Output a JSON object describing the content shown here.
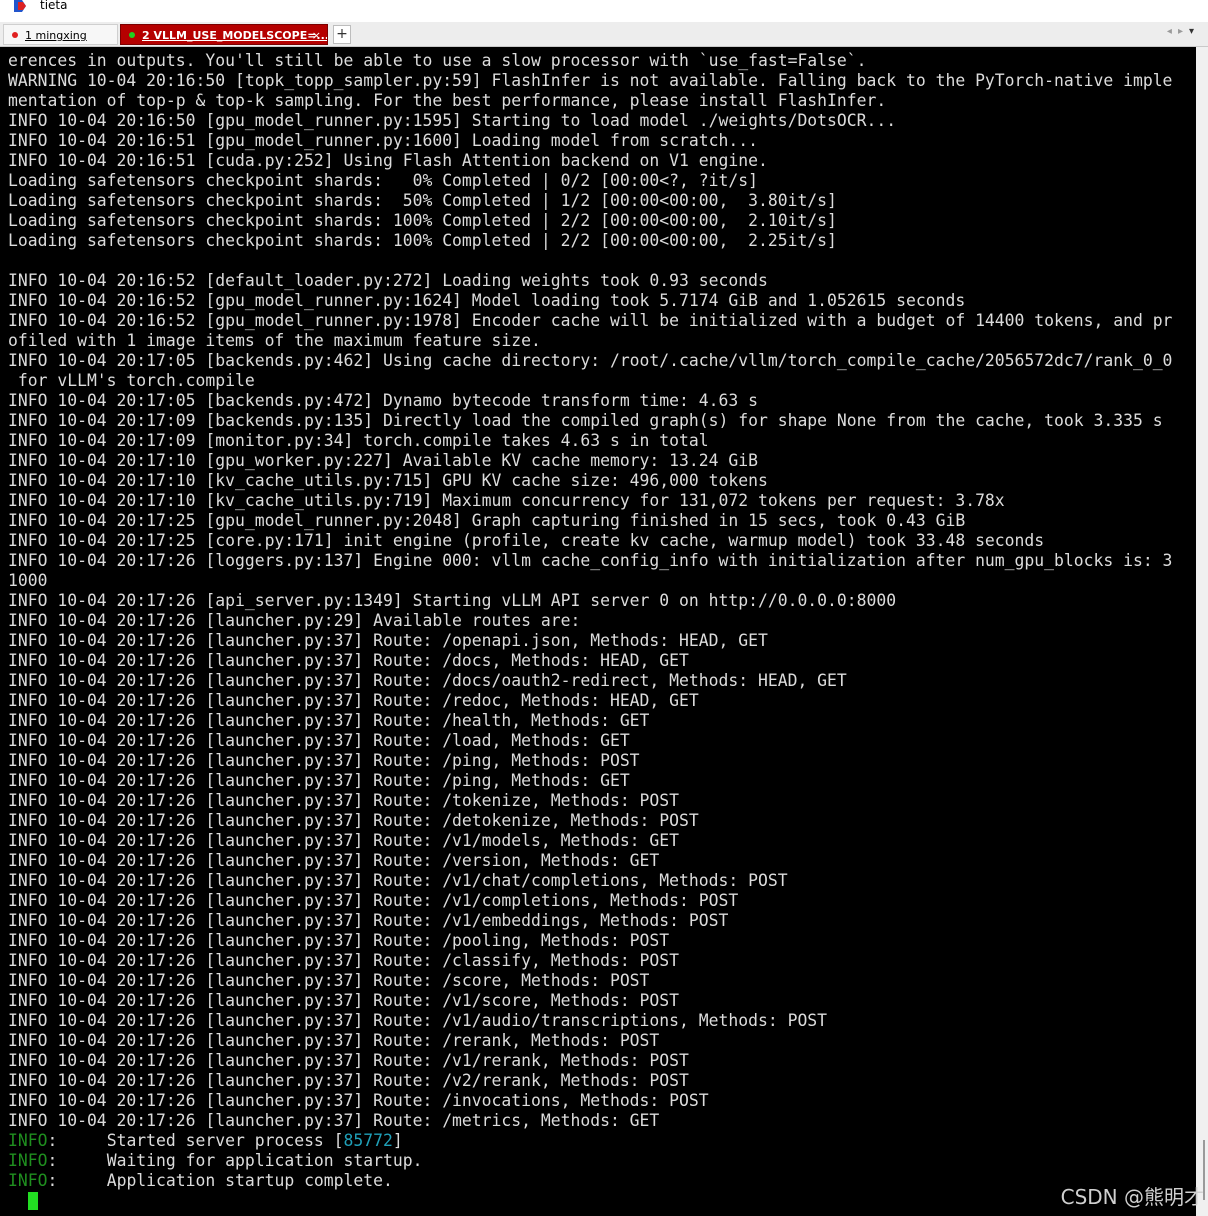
{
  "window": {
    "title": "tieta"
  },
  "tabs": [
    {
      "label": "1 mingxing",
      "dot_color": "#e02020",
      "active": false
    },
    {
      "label": "2 VLLM_USE_MODELSCOPE=...",
      "dot_color": "#20d020",
      "active": true,
      "close": "×"
    }
  ],
  "new_tab": "+",
  "tab_nav": {
    "prev": "◂",
    "next": "▸",
    "menu": "▾"
  },
  "terminal": {
    "lines": [
      "erences in outputs. You'll still be able to use a slow processor with `use_fast=False`.",
      "WARNING 10-04 20:16:50 [topk_topp_sampler.py:59] FlashInfer is not available. Falling back to the PyTorch-native imple",
      "mentation of top-p & top-k sampling. For the best performance, please install FlashInfer.",
      "INFO 10-04 20:16:50 [gpu_model_runner.py:1595] Starting to load model ./weights/DotsOCR...",
      "INFO 10-04 20:16:51 [gpu_model_runner.py:1600] Loading model from scratch...",
      "INFO 10-04 20:16:51 [cuda.py:252] Using Flash Attention backend on V1 engine.",
      "Loading safetensors checkpoint shards:   0% Completed | 0/2 [00:00<?, ?it/s]",
      "Loading safetensors checkpoint shards:  50% Completed | 1/2 [00:00<00:00,  3.80it/s]",
      "Loading safetensors checkpoint shards: 100% Completed | 2/2 [00:00<00:00,  2.10it/s]",
      "Loading safetensors checkpoint shards: 100% Completed | 2/2 [00:00<00:00,  2.25it/s]",
      "",
      "INFO 10-04 20:16:52 [default_loader.py:272] Loading weights took 0.93 seconds",
      "INFO 10-04 20:16:52 [gpu_model_runner.py:1624] Model loading took 5.7174 GiB and 1.052615 seconds",
      "INFO 10-04 20:16:52 [gpu_model_runner.py:1978] Encoder cache will be initialized with a budget of 14400 tokens, and pr",
      "ofiled with 1 image items of the maximum feature size.",
      "INFO 10-04 20:17:05 [backends.py:462] Using cache directory: /root/.cache/vllm/torch_compile_cache/2056572dc7/rank_0_0",
      " for vLLM's torch.compile",
      "INFO 10-04 20:17:05 [backends.py:472] Dynamo bytecode transform time: 4.63 s",
      "INFO 10-04 20:17:09 [backends.py:135] Directly load the compiled graph(s) for shape None from the cache, took 3.335 s",
      "INFO 10-04 20:17:09 [monitor.py:34] torch.compile takes 4.63 s in total",
      "INFO 10-04 20:17:10 [gpu_worker.py:227] Available KV cache memory: 13.24 GiB",
      "INFO 10-04 20:17:10 [kv_cache_utils.py:715] GPU KV cache size: 496,000 tokens",
      "INFO 10-04 20:17:10 [kv_cache_utils.py:719] Maximum concurrency for 131,072 tokens per request: 3.78x",
      "INFO 10-04 20:17:25 [gpu_model_runner.py:2048] Graph capturing finished in 15 secs, took 0.43 GiB",
      "INFO 10-04 20:17:25 [core.py:171] init engine (profile, create kv cache, warmup model) took 33.48 seconds",
      "INFO 10-04 20:17:26 [loggers.py:137] Engine 000: vllm cache_config_info with initialization after num_gpu_blocks is: 3",
      "1000",
      "INFO 10-04 20:17:26 [api_server.py:1349] Starting vLLM API server 0 on http://0.0.0.0:8000",
      "INFO 10-04 20:17:26 [launcher.py:29] Available routes are:",
      "INFO 10-04 20:17:26 [launcher.py:37] Route: /openapi.json, Methods: HEAD, GET",
      "INFO 10-04 20:17:26 [launcher.py:37] Route: /docs, Methods: HEAD, GET",
      "INFO 10-04 20:17:26 [launcher.py:37] Route: /docs/oauth2-redirect, Methods: HEAD, GET",
      "INFO 10-04 20:17:26 [launcher.py:37] Route: /redoc, Methods: HEAD, GET",
      "INFO 10-04 20:17:26 [launcher.py:37] Route: /health, Methods: GET",
      "INFO 10-04 20:17:26 [launcher.py:37] Route: /load, Methods: GET",
      "INFO 10-04 20:17:26 [launcher.py:37] Route: /ping, Methods: POST",
      "INFO 10-04 20:17:26 [launcher.py:37] Route: /ping, Methods: GET",
      "INFO 10-04 20:17:26 [launcher.py:37] Route: /tokenize, Methods: POST",
      "INFO 10-04 20:17:26 [launcher.py:37] Route: /detokenize, Methods: POST",
      "INFO 10-04 20:17:26 [launcher.py:37] Route: /v1/models, Methods: GET",
      "INFO 10-04 20:17:26 [launcher.py:37] Route: /version, Methods: GET",
      "INFO 10-04 20:17:26 [launcher.py:37] Route: /v1/chat/completions, Methods: POST",
      "INFO 10-04 20:17:26 [launcher.py:37] Route: /v1/completions, Methods: POST",
      "INFO 10-04 20:17:26 [launcher.py:37] Route: /v1/embeddings, Methods: POST",
      "INFO 10-04 20:17:26 [launcher.py:37] Route: /pooling, Methods: POST",
      "INFO 10-04 20:17:26 [launcher.py:37] Route: /classify, Methods: POST",
      "INFO 10-04 20:17:26 [launcher.py:37] Route: /score, Methods: POST",
      "INFO 10-04 20:17:26 [launcher.py:37] Route: /v1/score, Methods: POST",
      "INFO 10-04 20:17:26 [launcher.py:37] Route: /v1/audio/transcriptions, Methods: POST",
      "INFO 10-04 20:17:26 [launcher.py:37] Route: /rerank, Methods: POST",
      "INFO 10-04 20:17:26 [launcher.py:37] Route: /v1/rerank, Methods: POST",
      "INFO 10-04 20:17:26 [launcher.py:37] Route: /v2/rerank, Methods: POST",
      "INFO 10-04 20:17:26 [launcher.py:37] Route: /invocations, Methods: POST",
      "INFO 10-04 20:17:26 [launcher.py:37] Route: /metrics, Methods: GET"
    ],
    "colored_lines": [
      {
        "level": "INFO",
        "sep": ":     ",
        "text": "Started server process [",
        "pid": "85772",
        "tail": "]"
      },
      {
        "level": "INFO",
        "sep": ":     ",
        "text": "Waiting for application startup.",
        "pid": "",
        "tail": ""
      },
      {
        "level": "INFO",
        "sep": ":     ",
        "text": "Application startup complete.",
        "pid": "",
        "tail": ""
      }
    ],
    "colors": {
      "background": "#000000",
      "text": "#dcdcdc",
      "level": "#1f8f1f",
      "pid": "#1fa0b8",
      "cursor": "#22dd22"
    }
  },
  "watermark": "CSDN @熊明才"
}
